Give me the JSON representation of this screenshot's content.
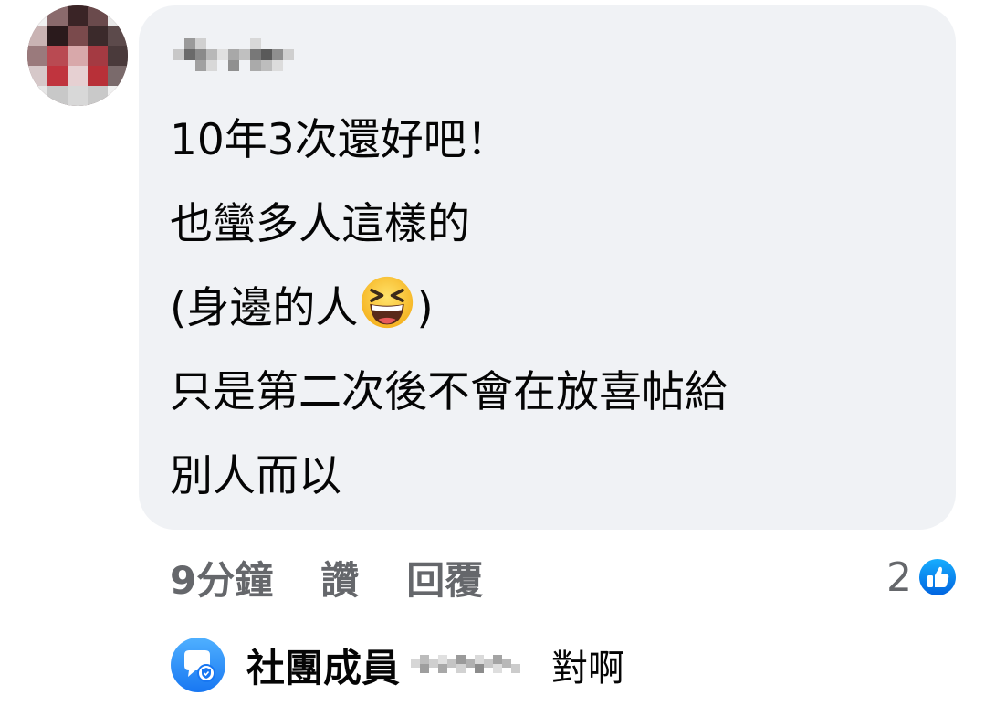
{
  "comment": {
    "avatar_icon": "profile-avatar-pixelated",
    "author_name_icon": "pixelated-name",
    "lines": [
      "10年3次還好吧！",
      "也蠻多人這樣的",
      "(身邊的人",
      ")",
      "只是第二次後不會在放喜帖給",
      "別人而以"
    ],
    "emoji": "grinning-squinting-face-emoji"
  },
  "actions": {
    "time": "9分鐘",
    "like": "讚",
    "reply": "回覆"
  },
  "reactions": {
    "count": "2",
    "icon": "like-thumb-icon",
    "color": "#1877f2"
  },
  "reply_preview": {
    "badge_icon": "group-member-badge-icon",
    "author_label": "社團成員",
    "author_name_icon": "pixelated-name",
    "text": "對啊"
  },
  "colors": {
    "bubble": "#f0f2f5",
    "secondary_text": "#65676b",
    "accent": "#1877f2"
  }
}
